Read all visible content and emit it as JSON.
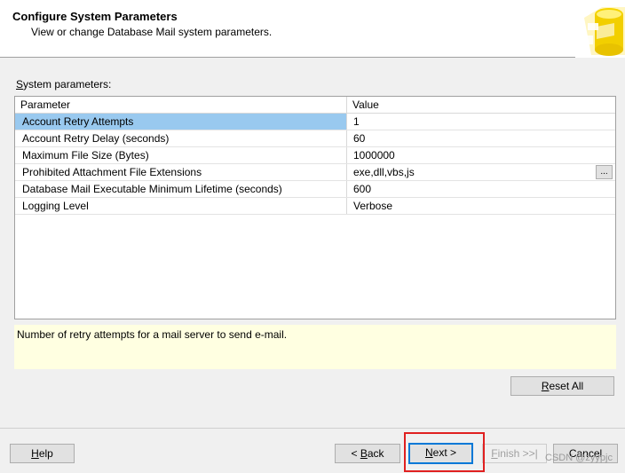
{
  "header": {
    "title": "Configure System Parameters",
    "subtitle": "View or change Database Mail system parameters."
  },
  "section_label_prefix": "S",
  "section_label_rest": "ystem parameters:",
  "grid": {
    "columns": [
      "Parameter",
      "Value"
    ],
    "rows": [
      {
        "parameter": "Account Retry Attempts",
        "value": "1"
      },
      {
        "parameter": "Account Retry Delay (seconds)",
        "value": "60"
      },
      {
        "parameter": "Maximum File Size (Bytes)",
        "value": "1000000"
      },
      {
        "parameter": "Prohibited Attachment File Extensions",
        "value": "exe,dll,vbs,js"
      },
      {
        "parameter": "Database Mail Executable Minimum Lifetime (seconds)",
        "value": "600"
      },
      {
        "parameter": "Logging Level",
        "value": "Verbose"
      }
    ],
    "ellipsis_label": "..."
  },
  "description": "Number of retry attempts for a mail server to send e-mail.",
  "buttons": {
    "reset_all": {
      "mnemonic": "R",
      "rest": "eset All"
    },
    "help": {
      "mnemonic": "H",
      "rest": "elp"
    },
    "back": {
      "prefix": "< ",
      "mnemonic": "B",
      "rest": "ack"
    },
    "next": {
      "mnemonic": "N",
      "rest": "ext >"
    },
    "finish": {
      "mnemonic": "F",
      "rest": "inish >>|"
    },
    "cancel": "Cancel"
  },
  "watermark": "CSDN @zyypjc",
  "colors": {
    "selection": "#99c9ef",
    "description_bg": "#ffffe1",
    "highlight": "#e02020",
    "default_button_border": "#0078d7"
  }
}
